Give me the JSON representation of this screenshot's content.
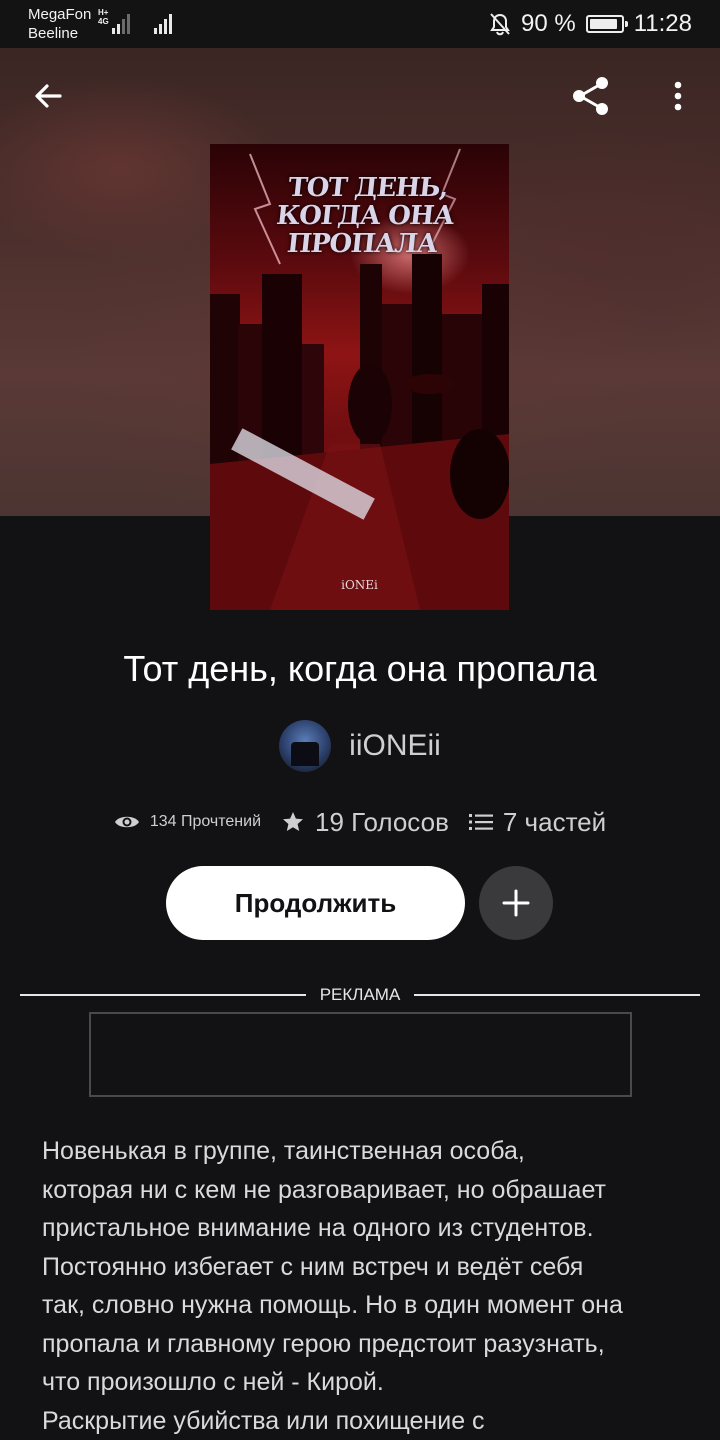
{
  "status_bar": {
    "carrier_1": "MegaFon",
    "carrier_2": "Beeline",
    "network_tag_1": "H+",
    "network_tag_2": "4G",
    "battery_percent": "90 %",
    "battery_level": 0.9,
    "time": "11:28",
    "icons": [
      "mute-bell-icon",
      "battery-icon",
      "signal-icon"
    ]
  },
  "toolbar": {
    "back_icon": "arrow-left-icon",
    "share_icon": "share-icon",
    "more_icon": "more-vertical-icon"
  },
  "cover": {
    "title_line_1": "ТОТ ДЕНЬ,",
    "title_line_2": "КОГДА ОНА ПРОПАЛА",
    "author": "iONEi"
  },
  "story": {
    "title": "Тот день, когда она пропала",
    "author": "iiONEii",
    "reads": "134 Прочтений",
    "votes": "19 Голосов",
    "parts": "7 частей"
  },
  "actions": {
    "continue_label": "Продолжить",
    "add_icon": "plus-icon"
  },
  "ad": {
    "label": "РЕКЛАМА"
  },
  "description": "Новенькая в группе, таинственная особа,\nкоторая ни с кем не разговаривает, но обрашает\nпристальное внимание на одного из студентов.\nПостоянно избегает с ним встреч и ведёт себя\nтак, словно нужна помощь. Но в один момент она\nпропала и главному герою предстоит разузнать,\nчто произошло с ней - Кирой.\nРаскрытие убийства или похищение с",
  "colors": {
    "background": "#121113",
    "accent_button": "#ffffff",
    "secondary_button": "#3a393c"
  }
}
